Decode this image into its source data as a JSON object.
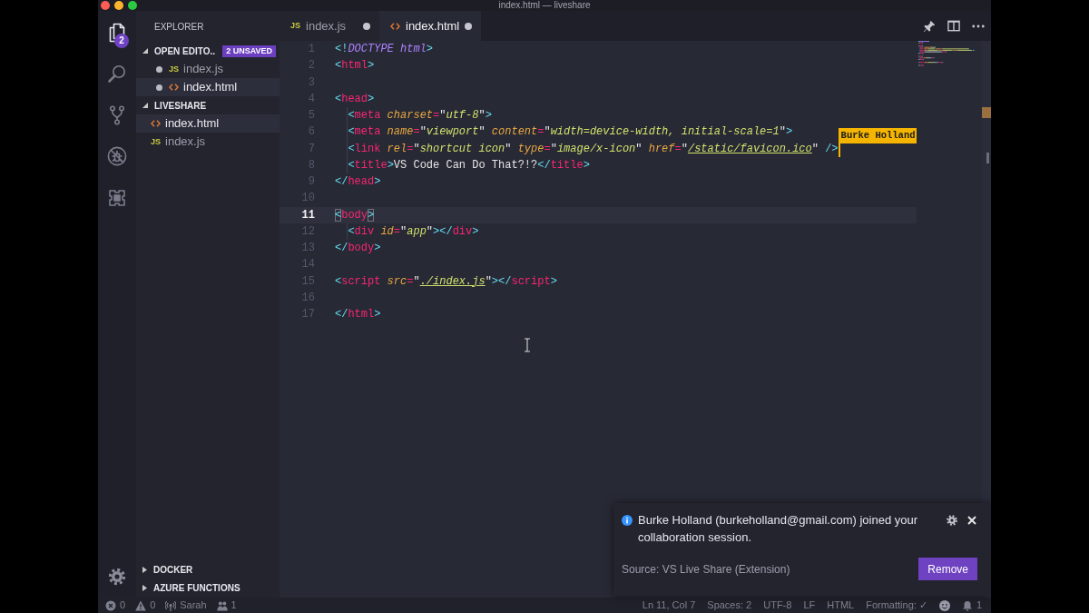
{
  "window": {
    "title": "index.html — liveshare"
  },
  "activity_bar": {
    "items": [
      {
        "kind": "explorer",
        "selected": true,
        "badge": "2"
      },
      {
        "kind": "search",
        "selected": false
      },
      {
        "kind": "source_control",
        "selected": false
      },
      {
        "kind": "debug",
        "selected": false
      },
      {
        "kind": "extensions",
        "selected": false
      }
    ]
  },
  "sidebar": {
    "title": "EXPLORER",
    "sections": [
      {
        "kind": "open_editors",
        "title": "OPEN EDITO..",
        "expanded": true,
        "badge": "2 UNSAVED",
        "items": [
          {
            "kind": "js",
            "icon_label": "JS",
            "name": "index.js",
            "dirty": true,
            "selected": false
          },
          {
            "kind": "html",
            "name": "index.html",
            "dirty": true,
            "selected": true
          }
        ]
      },
      {
        "kind": "folder",
        "title": "LIVESHARE",
        "expanded": true,
        "items": [
          {
            "kind": "html",
            "name": "index.html",
            "selected": true
          },
          {
            "kind": "js",
            "icon_label": "JS",
            "name": "index.js",
            "selected": false
          }
        ]
      },
      {
        "title": "DOCKER",
        "expanded": false
      },
      {
        "title": "AZURE FUNCTIONS",
        "expanded": false
      }
    ]
  },
  "tabs": [
    {
      "kind": "js",
      "icon_label": "JS",
      "label": "index.js",
      "dirty": true,
      "selected": false
    },
    {
      "kind": "html",
      "label": "index.html",
      "dirty": true,
      "selected": true
    }
  ],
  "editor": {
    "lines": [
      {
        "number": "1",
        "current": false,
        "tokens": [
          {
            "kind": "punct",
            "text": "<!"
          },
          {
            "kind": "doctype",
            "text": "DOCTYPE html"
          },
          {
            "kind": "punct",
            "text": ">"
          }
        ]
      },
      {
        "number": "2",
        "current": false,
        "tokens": [
          {
            "kind": "punct",
            "text": "<"
          },
          {
            "kind": "tag",
            "text": "html"
          },
          {
            "kind": "punct",
            "text": ">"
          }
        ]
      },
      {
        "number": "3",
        "current": false
      },
      {
        "number": "4",
        "current": false,
        "tokens": [
          {
            "kind": "punct",
            "text": "<"
          },
          {
            "kind": "tag",
            "text": "head"
          },
          {
            "kind": "punct",
            "text": ">"
          }
        ]
      },
      {
        "number": "5",
        "current": false,
        "tokens": [
          {
            "kind": "punct",
            "text": "  <"
          },
          {
            "kind": "tag",
            "text": "meta"
          },
          {
            "kind": "attr",
            "text": " charset"
          },
          {
            "kind": "eq",
            "text": "="
          },
          {
            "kind": "quote",
            "text": "\""
          },
          {
            "kind": "string",
            "text": "utf-8"
          },
          {
            "kind": "quote",
            "text": "\""
          },
          {
            "kind": "punct",
            "text": ">"
          }
        ]
      },
      {
        "number": "6",
        "current": false,
        "tokens": [
          {
            "kind": "punct",
            "text": "  <"
          },
          {
            "kind": "tag",
            "text": "meta"
          },
          {
            "kind": "attr",
            "text": " name"
          },
          {
            "kind": "eq",
            "text": "="
          },
          {
            "kind": "quote",
            "text": "\""
          },
          {
            "kind": "string",
            "text": "viewport"
          },
          {
            "kind": "quote",
            "text": "\""
          },
          {
            "kind": "attr",
            "text": " content"
          },
          {
            "kind": "eq",
            "text": "="
          },
          {
            "kind": "quote",
            "text": "\""
          },
          {
            "kind": "string",
            "text": "width=device-width, initial-scale=1"
          },
          {
            "kind": "quote",
            "text": "\""
          },
          {
            "kind": "punct",
            "text": ">"
          }
        ]
      },
      {
        "number": "7",
        "current": false,
        "tokens": [
          {
            "kind": "punct",
            "text": "  <"
          },
          {
            "kind": "tag",
            "text": "link"
          },
          {
            "kind": "attr",
            "text": " rel"
          },
          {
            "kind": "eq",
            "text": "="
          },
          {
            "kind": "quote",
            "text": "\""
          },
          {
            "kind": "string",
            "text": "shortcut icon"
          },
          {
            "kind": "quote",
            "text": "\""
          },
          {
            "kind": "attr",
            "text": " type"
          },
          {
            "kind": "eq",
            "text": "="
          },
          {
            "kind": "quote",
            "text": "\""
          },
          {
            "kind": "string",
            "text": "image/x-icon"
          },
          {
            "kind": "quote",
            "text": "\""
          },
          {
            "kind": "attr",
            "text": " href"
          },
          {
            "kind": "eq",
            "text": "="
          },
          {
            "kind": "quote",
            "text": "\""
          },
          {
            "kind": "link",
            "text": "/static/favicon.ico"
          },
          {
            "kind": "quote",
            "text": "\""
          },
          {
            "kind": "punct",
            "text": " />"
          }
        ],
        "collaborator": {
          "name": "Burke Holland",
          "color": "#f4b400"
        }
      },
      {
        "number": "8",
        "current": false,
        "tokens": [
          {
            "kind": "punct",
            "text": "  <"
          },
          {
            "kind": "tag",
            "text": "title"
          },
          {
            "kind": "punct",
            "text": ">"
          },
          {
            "kind": "text",
            "text": "VS Code Can Do That?!?"
          },
          {
            "kind": "punct",
            "text": "</"
          },
          {
            "kind": "tag",
            "text": "title"
          },
          {
            "kind": "punct",
            "text": ">"
          }
        ]
      },
      {
        "number": "9",
        "current": false,
        "tokens": [
          {
            "kind": "punct",
            "text": "</"
          },
          {
            "kind": "tag",
            "text": "head"
          },
          {
            "kind": "punct",
            "text": ">"
          }
        ]
      },
      {
        "number": "10",
        "current": false
      },
      {
        "number": "11",
        "current": true,
        "tokens": [
          {
            "kind": "bracket",
            "text": "<"
          },
          {
            "kind": "tag",
            "text": "body"
          },
          {
            "kind": "bracket",
            "text": ">"
          }
        ]
      },
      {
        "number": "12",
        "current": false,
        "tokens": [
          {
            "kind": "punct",
            "text": "  <"
          },
          {
            "kind": "tag",
            "text": "div"
          },
          {
            "kind": "attr",
            "text": " id"
          },
          {
            "kind": "eq",
            "text": "="
          },
          {
            "kind": "quote",
            "text": "\""
          },
          {
            "kind": "string",
            "text": "app"
          },
          {
            "kind": "quote",
            "text": "\""
          },
          {
            "kind": "punct",
            "text": "></"
          },
          {
            "kind": "tag",
            "text": "div"
          },
          {
            "kind": "punct",
            "text": ">"
          }
        ]
      },
      {
        "number": "13",
        "current": false,
        "tokens": [
          {
            "kind": "punct",
            "text": "</"
          },
          {
            "kind": "tag",
            "text": "body"
          },
          {
            "kind": "punct",
            "text": ">"
          }
        ]
      },
      {
        "number": "14",
        "current": false
      },
      {
        "number": "15",
        "current": false,
        "tokens": [
          {
            "kind": "punct",
            "text": "<"
          },
          {
            "kind": "tag",
            "text": "script"
          },
          {
            "kind": "attr",
            "text": " src"
          },
          {
            "kind": "eq",
            "text": "="
          },
          {
            "kind": "quote",
            "text": "\""
          },
          {
            "kind": "link",
            "text": "./index.js"
          },
          {
            "kind": "quote",
            "text": "\""
          },
          {
            "kind": "punct",
            "text": "></"
          },
          {
            "kind": "tag",
            "text": "script"
          },
          {
            "kind": "punct",
            "text": ">"
          }
        ]
      },
      {
        "number": "16",
        "current": false
      },
      {
        "number": "17",
        "current": false,
        "tokens": [
          {
            "kind": "punct",
            "text": "</"
          },
          {
            "kind": "tag",
            "text": "html"
          },
          {
            "kind": "punct",
            "text": ">"
          }
        ]
      }
    ]
  },
  "notification": {
    "message": "Burke Holland (burkeholland@gmail.com) joined your collaboration session.",
    "source": "Source: VS Live Share (Extension)",
    "actions": [
      "Remove"
    ]
  },
  "status_bar": {
    "left": [
      {
        "kind": "errors",
        "text": "0"
      },
      {
        "kind": "warnings",
        "text": "0"
      },
      {
        "kind": "broadcast",
        "text": "Sarah"
      },
      {
        "kind": "people",
        "text": "1"
      }
    ],
    "right": [
      {
        "kind": "text",
        "text": "Ln 11, Col 7"
      },
      {
        "kind": "text",
        "text": "Spaces: 2"
      },
      {
        "kind": "text",
        "text": "UTF-8"
      },
      {
        "kind": "text",
        "text": "LF"
      },
      {
        "kind": "text",
        "text": "HTML"
      },
      {
        "kind": "text",
        "text": "Formatting: ✓"
      },
      {
        "kind": "feedback"
      },
      {
        "kind": "notifications",
        "text": "1"
      }
    ]
  }
}
